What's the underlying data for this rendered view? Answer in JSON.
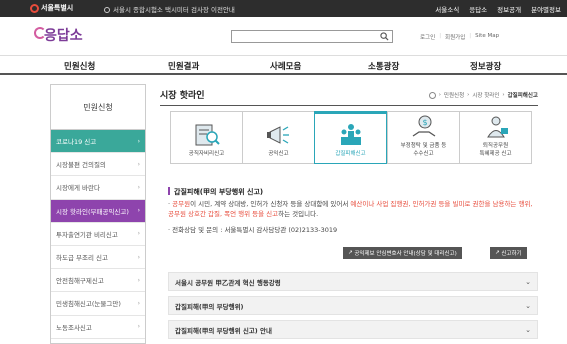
{
  "topbar": {
    "logo_text": "서울특별시",
    "notice": "서울시 종합시험소 택시미터 검사장 이전안내",
    "links": [
      "서울소식",
      "응답소",
      "정보공개",
      "분야별정보"
    ]
  },
  "header": {
    "brand": "응답소",
    "search_placeholder": "",
    "links": [
      "로그인",
      "회원가입",
      "Site Map"
    ]
  },
  "nav": {
    "items": [
      "민원신청",
      "민원결과",
      "사례모음",
      "소통광장",
      "정보광장"
    ]
  },
  "sidebar": {
    "title": "민원신청",
    "items": [
      "코로나19 신고",
      "시장불편 건의질의",
      "시장에게 바란다",
      "시장 핫라인(부패공익신고)",
      "투자출연기관 비리신고",
      "하도급 부조리 신고",
      "안전침해구제신고",
      "민생침해신고(눈물그만)",
      "노동조사신고"
    ]
  },
  "main": {
    "title": "시장 핫라인",
    "breadcrumb": [
      "민원신청",
      "시장 핫라인",
      "갑질피해신고"
    ],
    "tabs": [
      {
        "label": "공직자비리신고",
        "icon": "document-search-icon"
      },
      {
        "label": "공익신고",
        "icon": "megaphone-icon"
      },
      {
        "label": "갑질피해신고",
        "icon": "group-podium-icon"
      },
      {
        "label": "부정청탁 및 금품 등\n수수신고",
        "icon": "money-hand-icon"
      },
      {
        "label": "퇴직공무원\n특혜제공 신고",
        "icon": "retired-official-icon"
      }
    ],
    "section_title": "갑질피해(甲의 부당행위 신고)",
    "desc_1": "공무원",
    "desc_2": "이 시민, 계약 상대방, 인허가 신청자 등을 상대함에 있어서 ",
    "desc_3": "예산이나 사업 집행권, 인허가권 등을 빌미로 권한을 남용하는 행위, 공무원 상호간 갑질, 폭언 행위 등을 신고",
    "desc_4": "하는 것입니다.",
    "contact": "· 전화상담 및 문의 : 서울특별시 감사담당관 (02)2133-3019",
    "button_protect": "공익제보 안심변호사 안내(상담 및 대리신고)",
    "button_report": "신고하기",
    "accordion": [
      "서울시 공무원 甲乙관계 혁신 행동강령",
      "갑질피해(甲의 부당행위)",
      "갑질피해(甲의 부당행위 신고) 안내"
    ]
  },
  "colors": {
    "teal": "#3aa89a",
    "purple": "#8e44ad",
    "tab_accent": "#2aa6b8",
    "red": "#e74c3c"
  }
}
